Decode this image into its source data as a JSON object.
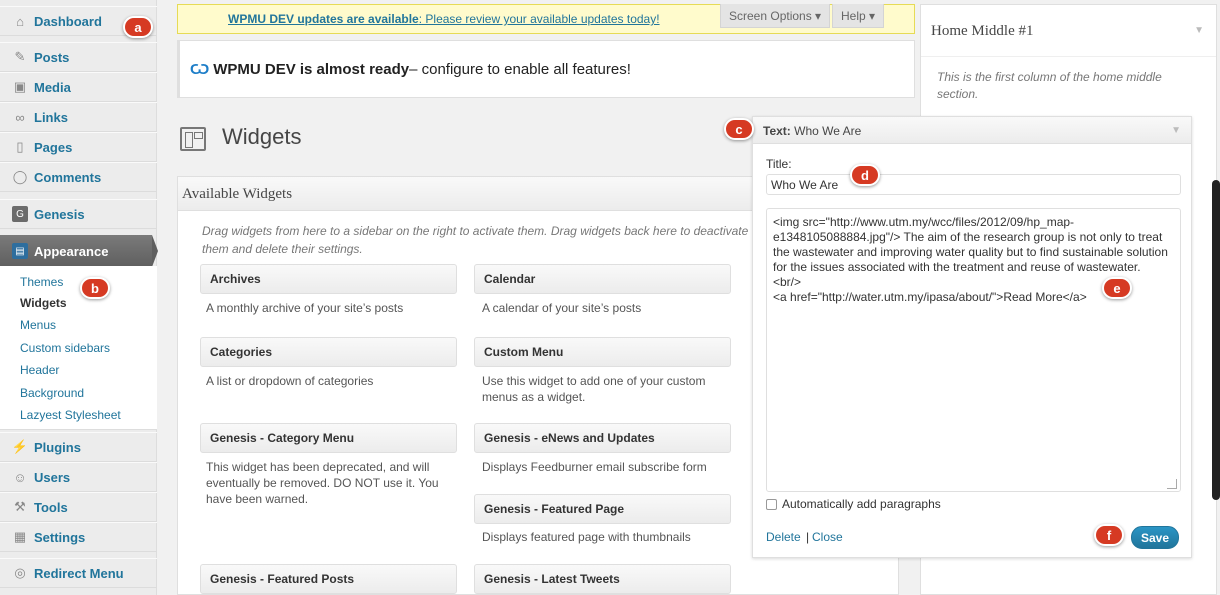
{
  "sidebar": {
    "items": [
      {
        "label": "Dashboard",
        "icon": "home-icon"
      },
      {
        "label": "Posts",
        "icon": "pushpin-icon"
      },
      {
        "label": "Media",
        "icon": "media-icon"
      },
      {
        "label": "Links",
        "icon": "link-icon"
      },
      {
        "label": "Pages",
        "icon": "page-icon"
      },
      {
        "label": "Comments",
        "icon": "comment-icon"
      },
      {
        "label": "Genesis",
        "icon": "genesis-icon"
      },
      {
        "label": "Appearance",
        "icon": "appearance-icon"
      },
      {
        "label": "Plugins",
        "icon": "plugin-icon"
      },
      {
        "label": "Users",
        "icon": "users-icon"
      },
      {
        "label": "Tools",
        "icon": "tools-icon"
      },
      {
        "label": "Settings",
        "icon": "settings-icon"
      },
      {
        "label": "Redirect Menu",
        "icon": "redirect-icon"
      }
    ],
    "submenu": [
      "Themes",
      "Widgets",
      "Menus",
      "Custom sidebars",
      "Header",
      "Background",
      "Lazyest Stylesheet"
    ]
  },
  "notice": {
    "bold": "WPMU DEV updates are available",
    "rest": ": Please review your available updates today!"
  },
  "top_tabs": {
    "screen_options": "Screen Options ▾",
    "help": "Help ▾"
  },
  "banner": {
    "logo": "Ѡ",
    "bold": "WPMU DEV is almost ready",
    "rest": " – configure to enable all features!"
  },
  "page_title": "Widgets",
  "available": {
    "heading": "Available Widgets",
    "description": "Drag widgets from here to a sidebar on the right to activate them. Drag widgets back here to deactivate them and delete their settings.",
    "widgets": [
      {
        "name": "Archives",
        "desc": "A monthly archive of your site’s posts"
      },
      {
        "name": "Calendar",
        "desc": "A calendar of your site’s posts"
      },
      {
        "name": "Categories",
        "desc": "A list or dropdown of categories"
      },
      {
        "name": "Custom Menu",
        "desc": "Use this widget to add one of your custom menus as a widget."
      },
      {
        "name": "Genesis - Category Menu",
        "desc": "This widget has been deprecated, and will eventually be removed. DO NOT use it. You have been warned."
      },
      {
        "name": "Genesis - eNews and Updates",
        "desc": "Displays Feedburner email subscribe form"
      },
      {
        "name": "Genesis - Featured Page",
        "desc": "Displays featured page with thumbnails"
      },
      {
        "name": "Genesis - Featured Posts",
        "desc": ""
      },
      {
        "name": "Genesis - Latest Tweets",
        "desc": ""
      }
    ]
  },
  "home_middle": {
    "title": "Home Middle #1",
    "desc": "This is the first column of the home middle section."
  },
  "text_widget": {
    "head_bold": "Text:",
    "head_rest": " Who We Are",
    "title_label": "Title:",
    "title_value": "Who We Are",
    "content": "<img src=\"http://www.utm.my/wcc/files/2012/09/hp_map-e1348105088884.jpg\"/> The aim of the research group is not only to treat the wastewater and improving water quality but to find sustainable solution for the issues associated with the treatment and reuse of wastewater.\n<br/>\n<a href=\"http://water.utm.my/ipasa/about/\">Read More</a>",
    "autop_label": "Automatically add paragraphs",
    "delete": "Delete",
    "separator": "|",
    "close": "Close",
    "save": "Save"
  },
  "markers": [
    "a",
    "b",
    "c",
    "d",
    "e",
    "f"
  ],
  "colors": {
    "accent": "#21759b",
    "marker": "#d63a23",
    "notice_bg": "#fffbcc"
  }
}
